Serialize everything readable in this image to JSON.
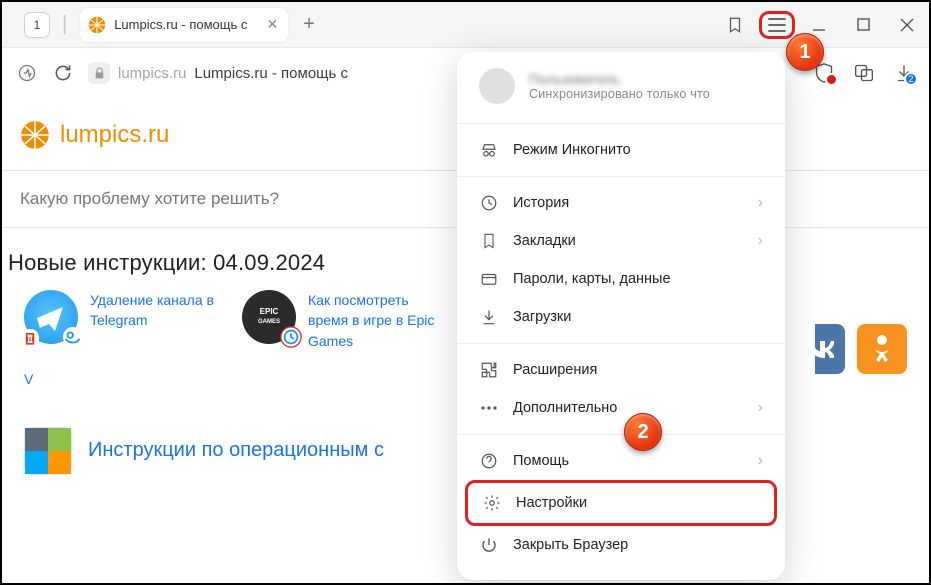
{
  "titlebar": {
    "counter": "1",
    "tab_title": "Lumpics.ru - помощь с"
  },
  "addr": {
    "host": "lumpics.ru",
    "page_title": "Lumpics.ru - помощь с",
    "dl_badge": "2"
  },
  "site": {
    "name": "lumpics.ru"
  },
  "search": {
    "placeholder": "Какую проблему хотите решить?"
  },
  "section": {
    "title": "Новые инструкции: 04.09.2024"
  },
  "articles": [
    {
      "title": "Удаление канала в Telegram"
    },
    {
      "title": "Как посмотреть время в игре в Epic Games"
    }
  ],
  "os": {
    "label": "Инструкции по операционным с"
  },
  "profile": {
    "name": "Пользователь",
    "sub": "Синхронизировано только что"
  },
  "menu": {
    "incognito": "Режим Инкогнито",
    "history": "История",
    "bookmarks": "Закладки",
    "passwords": "Пароли, карты, данные",
    "downloads": "Загрузки",
    "extensions": "Расширения",
    "more": "Дополнительно",
    "help": "Помощь",
    "settings": "Настройки",
    "close": "Закрыть Браузер"
  },
  "markers": {
    "m1": "1",
    "m2": "2"
  }
}
